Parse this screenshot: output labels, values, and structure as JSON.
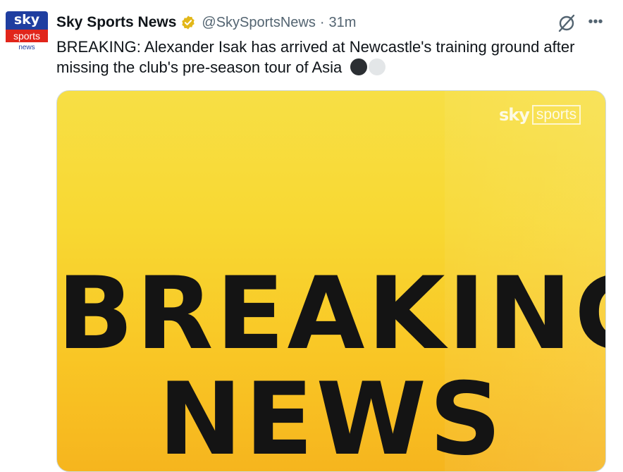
{
  "account": {
    "name": "Sky Sports News",
    "handle": "@SkySportsNews",
    "separator": "·",
    "time": "31m",
    "avatar": {
      "line1": "sky",
      "line2": "sports",
      "line3": "news"
    }
  },
  "tweet": {
    "text": "BREAKING: Alexander Isak has arrived at Newcastle's training ground after missing the club's pre-season tour of Asia",
    "emojis": [
      "black-circle",
      "white-circle"
    ]
  },
  "media": {
    "logo_sky": "sky",
    "logo_sports": "sports",
    "headline_line1": "BREAKING",
    "headline_line2": "NEWS"
  },
  "icons": {
    "verified": "verified-badge-icon",
    "grok": "grok-icon",
    "more": "more-icon"
  },
  "colors": {
    "verified_gold": "#e2b719",
    "banner_yellow": "#f8d832",
    "avatar_blue": "#1f3ea0",
    "avatar_red": "#e1251b"
  }
}
